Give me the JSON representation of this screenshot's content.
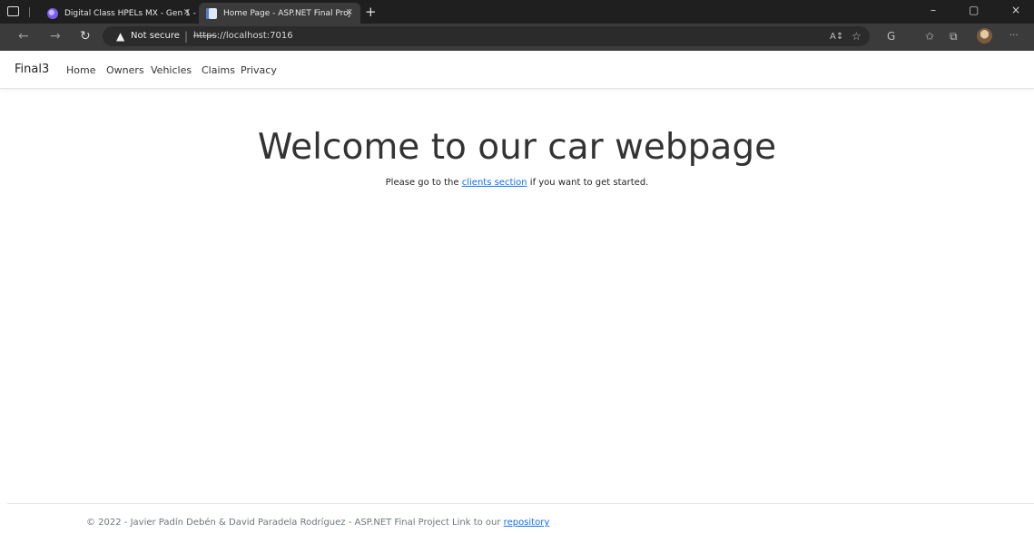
{
  "browser": {
    "tabs": [
      {
        "title": "Digital Class HPELs MX - Gen 1 -",
        "close": "×"
      },
      {
        "title": "Home Page - ASP.NET Final Proj",
        "close": "×"
      }
    ],
    "new_tab": "+",
    "window_buttons": {
      "minimize": "–",
      "restore": "▢",
      "close": "×"
    },
    "nav": {
      "back": "←",
      "forward": "→",
      "refresh": "↻"
    },
    "address": {
      "warning_icon": "▲",
      "not_secure": "Not secure",
      "separator": "|",
      "scheme": "https",
      "rest": "://localhost:7016"
    },
    "toolbar_icons": {
      "read_aloud": "A↕",
      "favorite": "☆",
      "copilot": "G",
      "favorites": "✩",
      "collections": "⧉",
      "more": "···"
    }
  },
  "site": {
    "brand": "Final3",
    "nav": [
      "Home",
      "Owners",
      "Vehicles",
      "Claims",
      "Privacy"
    ]
  },
  "main": {
    "heading": "Welcome to our car webpage",
    "lead_before": "Please go to the ",
    "lead_link": "clients section",
    "lead_after": " if you want to get started."
  },
  "footer": {
    "text": "© 2022 - Javier Padín Debén & David Paradela Rodríguez - ASP.NET Final Project Link to our ",
    "link": "repository"
  }
}
